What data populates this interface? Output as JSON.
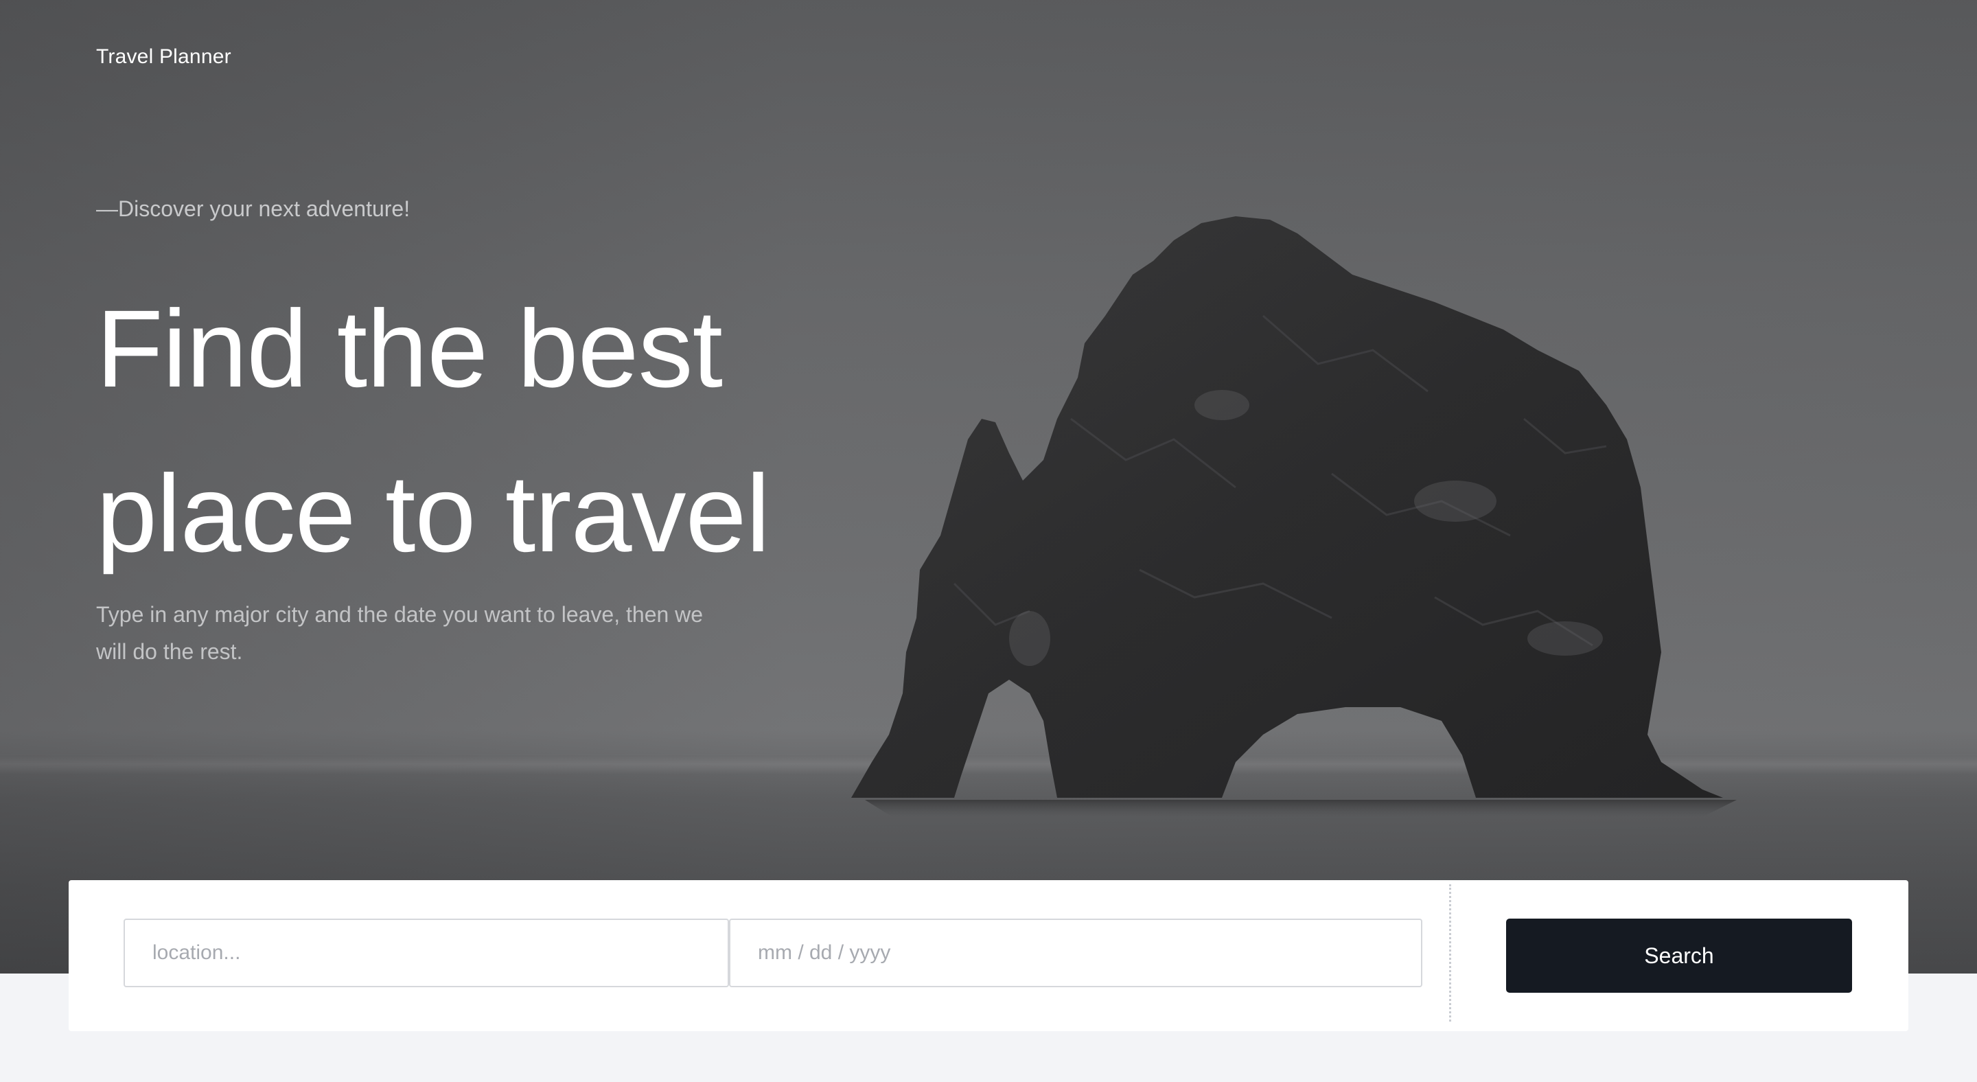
{
  "header": {
    "brand": "Travel Planner"
  },
  "hero": {
    "tagline": "—Discover your next adventure!",
    "headline_line1": "Find the best",
    "headline_line2": "place to travel",
    "subtext": "Type in any major city and the date you want to leave, then we will do the rest."
  },
  "search": {
    "location_placeholder": "location...",
    "location_value": "",
    "date_placeholder": "mm / dd / yyyy",
    "date_value": "",
    "button_label": "Search"
  },
  "colors": {
    "button_bg": "#151a22",
    "page_bg": "#f3f4f7",
    "card_bg": "#ffffff"
  }
}
